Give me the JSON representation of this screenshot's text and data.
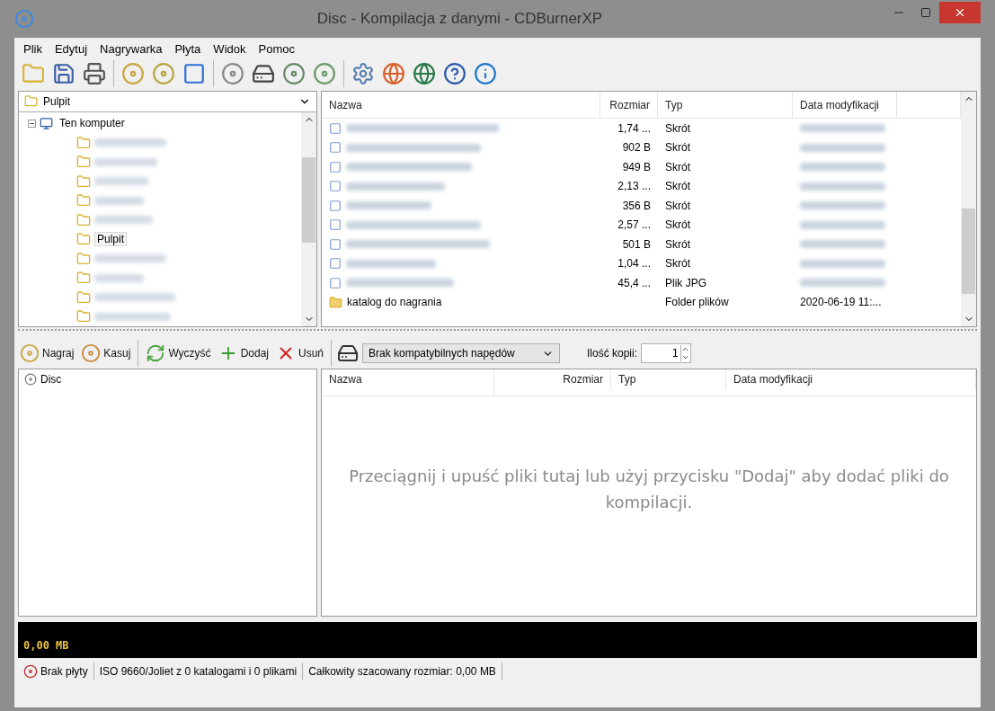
{
  "window": {
    "title": "Disc - Kompilacja z danymi - CDBurnerXP"
  },
  "menu": [
    "Plik",
    "Edytuj",
    "Nagrywarka",
    "Płyta",
    "Widok",
    "Pomoc"
  ],
  "browser": {
    "location": "Pulpit",
    "tree": [
      {
        "label": "Ten komputer",
        "selected": false,
        "expanded": true,
        "children": [
          {
            "selected": false
          },
          {
            "selected": false
          },
          {
            "selected": false
          },
          {
            "selected": false
          },
          {
            "selected": false
          },
          {
            "label": "Pulpit",
            "selected": true
          },
          {
            "selected": false
          },
          {
            "selected": false
          },
          {
            "selected": false
          },
          {
            "selected": false
          }
        ]
      }
    ],
    "columns": [
      "Nazwa",
      "Rozmiar",
      "Typ",
      "Data modyfikacji"
    ],
    "rows": [
      {
        "size": "1,74 ...",
        "type": "Skrót"
      },
      {
        "size": "902 B",
        "type": "Skrót"
      },
      {
        "size": "949 B",
        "type": "Skrót"
      },
      {
        "size": "2,13 ...",
        "type": "Skrót"
      },
      {
        "size": "356 B",
        "type": "Skrót"
      },
      {
        "size": "2,57 ...",
        "type": "Skrót"
      },
      {
        "size": "501 B",
        "type": "Skrót"
      },
      {
        "size": "1,04 ...",
        "type": "Skrót"
      },
      {
        "size": "45,4 ...",
        "type": "Plik JPG"
      },
      {
        "name": "katalog do nagrania",
        "type": "Folder plików",
        "date": "2020-06-19 11:..."
      }
    ]
  },
  "actions": [
    {
      "kind": "burn",
      "label": "Nagraj"
    },
    {
      "kind": "erase",
      "label": "Kasuj"
    },
    {
      "kind": "clear",
      "label": "Wyczyść"
    },
    {
      "kind": "add",
      "label": "Dodaj"
    },
    {
      "kind": "remove",
      "label": "Usuń"
    }
  ],
  "drive": {
    "value": "Brak kompatybilnych napędów"
  },
  "copies": {
    "label": "Ilość kopii:",
    "value": "1"
  },
  "compilation": {
    "root": "Disc",
    "columns": [
      "Nazwa",
      "Rozmiar",
      "Typ",
      "Data modyfikacji"
    ],
    "empty_message": "Przeciągnij i upuść pliki tutaj lub użyj przycisku \"Dodaj\" aby dodać pliki do kompilacji."
  },
  "size_bar": {
    "label": "0,00 MB"
  },
  "status_bar": [
    "Brak płyty",
    "ISO 9660/Joliet z 0 katalogami i 0 plikami",
    "Całkowity szacowany rozmiar: 0,00 MB"
  ]
}
